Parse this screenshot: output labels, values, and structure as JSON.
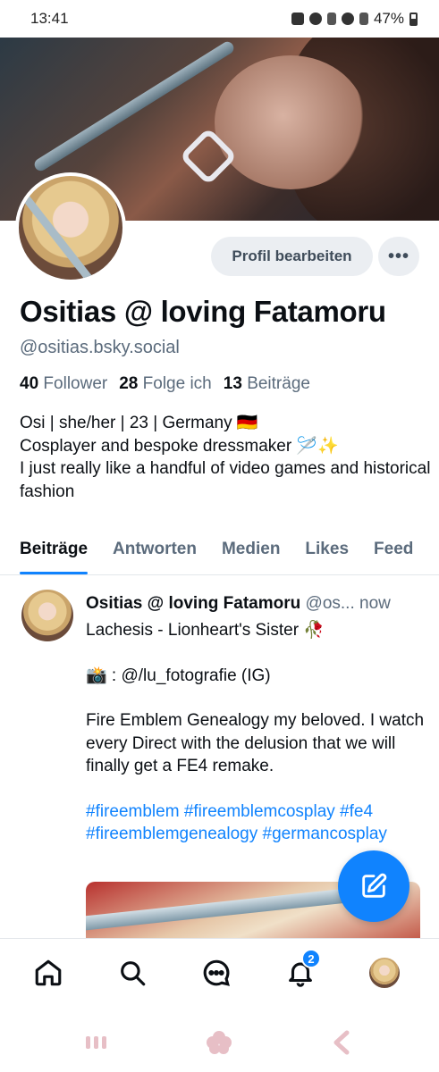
{
  "status_bar": {
    "time": "13:41",
    "battery": "47%"
  },
  "profile": {
    "edit_button": "Profil bearbeiten",
    "more_button": "•••",
    "display_name": "Ositias @ loving Fatamoru",
    "handle": "@ositias.bsky.social",
    "stats": {
      "followers_count": "40",
      "followers_label": "Follower",
      "following_count": "28",
      "following_label": "Folge ich",
      "posts_count": "13",
      "posts_label": "Beiträge"
    },
    "bio": [
      "Osi | she/her | 23 | Germany 🇩🇪",
      "Cosplayer and bespoke dressmaker 🪡✨",
      "I just really like a handful of video games and historical fashion"
    ]
  },
  "tabs": [
    {
      "label": "Beiträge",
      "active": true
    },
    {
      "label": "Antworten"
    },
    {
      "label": "Medien"
    },
    {
      "label": "Likes"
    },
    {
      "label": "Feed"
    }
  ],
  "post": {
    "author": "Ositias @ loving Fatamoru",
    "handle_short": "@os...",
    "time": "now",
    "line1": "Lachesis - Lionheart's Sister 🥀",
    "line2": "📸 : @/lu_fotografie (IG)",
    "line3": "Fire Emblem Genealogy my beloved. I watch every Direct with the delusion that we will finally get a FE4 remake.",
    "tags": "#fireemblem #fireemblemcosplay #fe4 #fireemblemgenealogy #germancosplay"
  },
  "bottom_nav": {
    "notifications_badge": "2",
    "items": [
      "home-icon",
      "search-icon",
      "chat-icon",
      "bell-icon",
      "profile-avatar"
    ]
  },
  "colors": {
    "accent": "#1083fe",
    "text": "#0b0f14",
    "muted": "#5b6b7c"
  }
}
